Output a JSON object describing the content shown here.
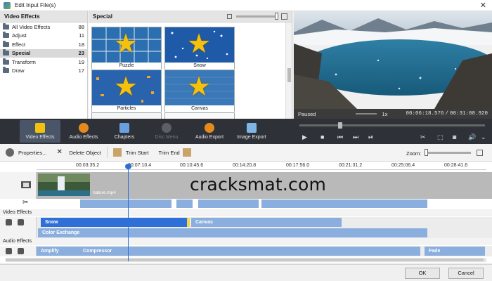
{
  "window": {
    "title": "Edit Input File(s)",
    "close_glyph": "✕"
  },
  "categories": {
    "header": "Video Effects",
    "items": [
      {
        "label": "All Video Effects",
        "count": "88"
      },
      {
        "label": "Adjust",
        "count": "11"
      },
      {
        "label": "Effect",
        "count": "18"
      },
      {
        "label": "Special",
        "count": "23"
      },
      {
        "label": "Transform",
        "count": "19"
      },
      {
        "label": "Draw",
        "count": "17"
      }
    ]
  },
  "gallery": {
    "header": "Special",
    "thumbs": [
      {
        "caption": "Puzzle"
      },
      {
        "caption": "Snow"
      },
      {
        "caption": "Particles"
      },
      {
        "caption": "Canvas"
      }
    ]
  },
  "preview": {
    "state": "Paused",
    "speed": "1x",
    "current_time": "00:06:18.576",
    "separator": "/",
    "total_time": "00:31:08.920"
  },
  "toolbar": {
    "tabs": [
      {
        "label": "Video Effects",
        "icon": "star-icon"
      },
      {
        "label": "Audio Effects",
        "icon": "speaker-icon"
      },
      {
        "label": "Chapters",
        "icon": "film-icon"
      },
      {
        "label": "Disc Menu",
        "icon": "disc-icon"
      },
      {
        "label": "Audio Export",
        "icon": "speaker-icon"
      },
      {
        "label": "Image Export",
        "icon": "image-icon"
      }
    ]
  },
  "edit_toolbar": {
    "properties": "Properties...",
    "delete": "Delete Object",
    "trim_start": "Trim Start",
    "trim_end": "Trim End",
    "zoom_label": "Zoom:"
  },
  "timeline": {
    "ticks": [
      "00:03:35.2",
      "00:07:10.4",
      "00:10:45.6",
      "00:14:20.8",
      "00:17:56.0",
      "00:21:31.2",
      "00:25:06.4",
      "00:28:41.6"
    ],
    "clip_name": "nature.mp4",
    "video_effects_header": "Video Effects",
    "audio_effects_header": "Audio Effects",
    "video_bars": {
      "snow": "Snow",
      "canvas": "Canvas",
      "color_exchange": "Color Exchange"
    },
    "audio_bars": {
      "amplify": "Amplify",
      "compressor": "Compressor",
      "fade": "Fade"
    }
  },
  "buttons": {
    "ok": "OK",
    "cancel": "Cancel"
  },
  "watermark": "cracksmat.com",
  "colors": {
    "accent": "#2a6fd6",
    "toolbar_bg": "#2e3238",
    "bar_blue": "#8aaedd",
    "snow_bar": "#2f6fd8",
    "star": "#f4c20d"
  }
}
